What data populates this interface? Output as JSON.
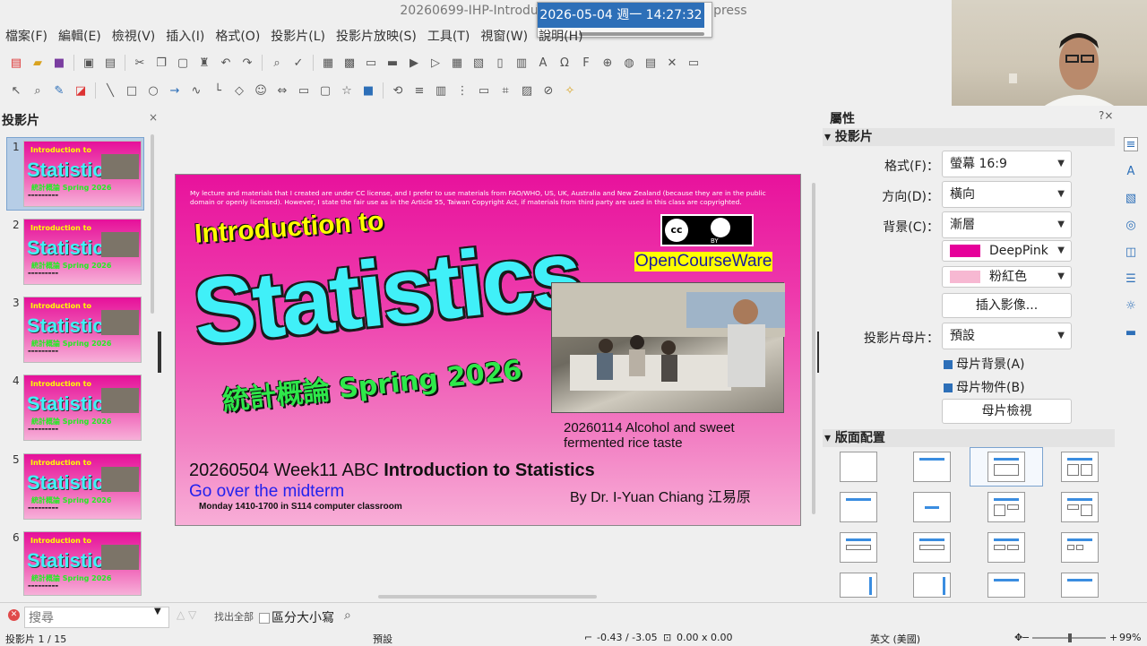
{
  "window": {
    "title": "20260699-IHP-Introduction to st... - LibreOffice Impress"
  },
  "clock": {
    "text": "2026-05-04 週一 14:27:32"
  },
  "menu": [
    "檔案(F)",
    "編輯(E)",
    "檢視(V)",
    "插入(I)",
    "格式(O)",
    "投影片(L)",
    "投影片放映(S)",
    "工具(T)",
    "視窗(W)",
    "說明(H)"
  ],
  "slides_panel": {
    "title": "投影片",
    "close": "×",
    "numbers": [
      "1",
      "2",
      "3",
      "4",
      "5",
      "6"
    ]
  },
  "slide": {
    "license": "My lecture and materials that I created are under CC license, and I prefer to use materials from FAO/WHO, US, UK, Australia and New Zealand (because they are in the public domain or openly licensed). However, I  state the fair use as in the Article 55, Taiwan Copyright Act, if materials from third party are used in this class are copyrighted.",
    "cc": "cc",
    "cc_by": "BY",
    "ocw": "OpenCourseWare",
    "intro": "Introduction to",
    "statistics": "Statistics",
    "chinese": "統計概論 Spring 2026",
    "caption": "20260114 Alcohol and sweet fermented rice taste",
    "week_prefix": "20260504 Week11 ABC",
    "week_title": "Introduction to Statistics",
    "go_over": "Go over the midterm",
    "by": "By Dr. I-Yuan Chiang 江易原",
    "monday": "Monday 1410-1700 in S114   computer classroom"
  },
  "properties": {
    "title": "屬性",
    "close": "?×",
    "section_slide": "投影片",
    "format_label": "格式(F)：",
    "format_value": "螢幕 16:9",
    "orientation_label": "方向(D)：",
    "orientation_value": "橫向",
    "background_label": "背景(C)：",
    "background_value": "漸層",
    "color1": "DeepPink",
    "color1_hex": "#e6009a",
    "color2": "粉紅色",
    "color2_hex": "#f7b8d2",
    "insert_image": "插入影像...",
    "master_label": "投影片母片：",
    "master_value": "預設",
    "master_bg": "母片背景(A)",
    "master_objects": "母片物件(B)",
    "master_view": "母片檢視",
    "section_layout": "版面配置"
  },
  "findbar": {
    "placeholder": "搜尋",
    "find_all": "找出全部",
    "match_case": "區分大小寫"
  },
  "status": {
    "slide": "投影片 1 / 15",
    "master": "預設",
    "position": "-0.43 / -3.05",
    "size": "0.00 x 0.00",
    "language": "英文 (美國)",
    "zoom": "99%"
  }
}
